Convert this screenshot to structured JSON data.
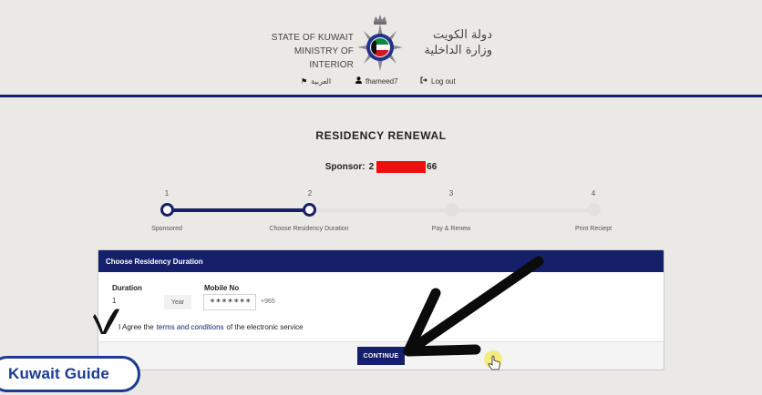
{
  "header": {
    "state_en_line1": "STATE OF KUWAIT",
    "state_en_line2": "MINISTRY OF INTERIOR",
    "state_ar_line1": "دولة الكويت",
    "state_ar_line2": "وزارة الداخلية",
    "emblem_icon": "kuwait-moi-emblem-icon",
    "nav": {
      "arabic": "العربية",
      "arabic_icon": "flag-icon",
      "user": "fhameed7",
      "user_icon": "user-icon",
      "logout": "Log out",
      "logout_icon": "logout-icon"
    },
    "accent_color": "#16206a"
  },
  "page": {
    "title": "RESIDENCY RENEWAL",
    "sponsor_label": "Sponsor:",
    "sponsor_prefix": "2",
    "sponsor_suffix": "66",
    "redaction_color": "#ef0f0f"
  },
  "stepper": {
    "steps": [
      {
        "number": "1",
        "label": "Sponsored",
        "state": "complete"
      },
      {
        "number": "2",
        "label": "Choose Residency Duration",
        "state": "current"
      },
      {
        "number": "3",
        "label": "Pay & Renew",
        "state": "pending"
      },
      {
        "number": "4",
        "label": "Print Reciept",
        "state": "pending"
      }
    ]
  },
  "form": {
    "panel_title": "Choose Residency Duration",
    "duration_label": "Duration",
    "duration_value": "1",
    "duration_unit": "Year",
    "mobile_label": "Mobile No",
    "mobile_value": "*******",
    "country_code": "+965",
    "agree_prefix": "I Agree the",
    "agree_link": "terms and conditions",
    "agree_suffix": "of the electronic service",
    "checkbox_checked": true,
    "continue_label": "CONTINUE"
  },
  "overlay": {
    "badge_text": "Kuwait Guide",
    "badge_color": "#1c3b92",
    "checkmark_icon": "handwritten-check-icon",
    "arrow_icon": "pointer-arrow-icon",
    "cursor_icon": "hand-cursor-icon"
  }
}
